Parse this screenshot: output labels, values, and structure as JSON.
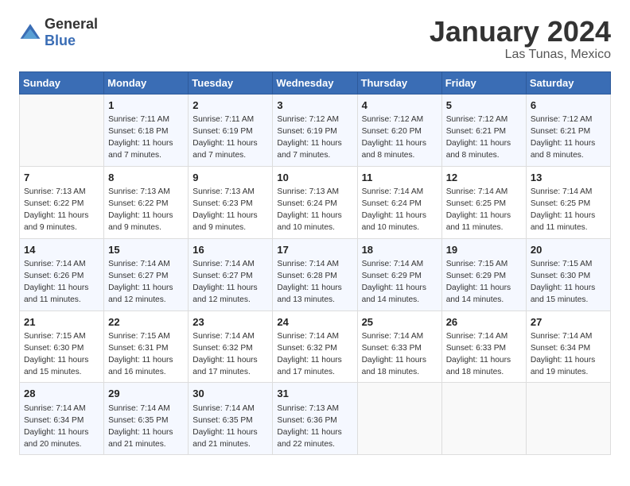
{
  "header": {
    "logo_general": "General",
    "logo_blue": "Blue",
    "month_title": "January 2024",
    "location": "Las Tunas, Mexico"
  },
  "calendar": {
    "days_of_week": [
      "Sunday",
      "Monday",
      "Tuesday",
      "Wednesday",
      "Thursday",
      "Friday",
      "Saturday"
    ],
    "weeks": [
      [
        {
          "day": "",
          "info": ""
        },
        {
          "day": "1",
          "info": "Sunrise: 7:11 AM\nSunset: 6:18 PM\nDaylight: 11 hours\nand 7 minutes."
        },
        {
          "day": "2",
          "info": "Sunrise: 7:11 AM\nSunset: 6:19 PM\nDaylight: 11 hours\nand 7 minutes."
        },
        {
          "day": "3",
          "info": "Sunrise: 7:12 AM\nSunset: 6:19 PM\nDaylight: 11 hours\nand 7 minutes."
        },
        {
          "day": "4",
          "info": "Sunrise: 7:12 AM\nSunset: 6:20 PM\nDaylight: 11 hours\nand 8 minutes."
        },
        {
          "day": "5",
          "info": "Sunrise: 7:12 AM\nSunset: 6:21 PM\nDaylight: 11 hours\nand 8 minutes."
        },
        {
          "day": "6",
          "info": "Sunrise: 7:12 AM\nSunset: 6:21 PM\nDaylight: 11 hours\nand 8 minutes."
        }
      ],
      [
        {
          "day": "7",
          "info": "Sunrise: 7:13 AM\nSunset: 6:22 PM\nDaylight: 11 hours\nand 9 minutes."
        },
        {
          "day": "8",
          "info": "Sunrise: 7:13 AM\nSunset: 6:22 PM\nDaylight: 11 hours\nand 9 minutes."
        },
        {
          "day": "9",
          "info": "Sunrise: 7:13 AM\nSunset: 6:23 PM\nDaylight: 11 hours\nand 9 minutes."
        },
        {
          "day": "10",
          "info": "Sunrise: 7:13 AM\nSunset: 6:24 PM\nDaylight: 11 hours\nand 10 minutes."
        },
        {
          "day": "11",
          "info": "Sunrise: 7:14 AM\nSunset: 6:24 PM\nDaylight: 11 hours\nand 10 minutes."
        },
        {
          "day": "12",
          "info": "Sunrise: 7:14 AM\nSunset: 6:25 PM\nDaylight: 11 hours\nand 11 minutes."
        },
        {
          "day": "13",
          "info": "Sunrise: 7:14 AM\nSunset: 6:25 PM\nDaylight: 11 hours\nand 11 minutes."
        }
      ],
      [
        {
          "day": "14",
          "info": "Sunrise: 7:14 AM\nSunset: 6:26 PM\nDaylight: 11 hours\nand 11 minutes."
        },
        {
          "day": "15",
          "info": "Sunrise: 7:14 AM\nSunset: 6:27 PM\nDaylight: 11 hours\nand 12 minutes."
        },
        {
          "day": "16",
          "info": "Sunrise: 7:14 AM\nSunset: 6:27 PM\nDaylight: 11 hours\nand 12 minutes."
        },
        {
          "day": "17",
          "info": "Sunrise: 7:14 AM\nSunset: 6:28 PM\nDaylight: 11 hours\nand 13 minutes."
        },
        {
          "day": "18",
          "info": "Sunrise: 7:14 AM\nSunset: 6:29 PM\nDaylight: 11 hours\nand 14 minutes."
        },
        {
          "day": "19",
          "info": "Sunrise: 7:15 AM\nSunset: 6:29 PM\nDaylight: 11 hours\nand 14 minutes."
        },
        {
          "day": "20",
          "info": "Sunrise: 7:15 AM\nSunset: 6:30 PM\nDaylight: 11 hours\nand 15 minutes."
        }
      ],
      [
        {
          "day": "21",
          "info": "Sunrise: 7:15 AM\nSunset: 6:30 PM\nDaylight: 11 hours\nand 15 minutes."
        },
        {
          "day": "22",
          "info": "Sunrise: 7:15 AM\nSunset: 6:31 PM\nDaylight: 11 hours\nand 16 minutes."
        },
        {
          "day": "23",
          "info": "Sunrise: 7:14 AM\nSunset: 6:32 PM\nDaylight: 11 hours\nand 17 minutes."
        },
        {
          "day": "24",
          "info": "Sunrise: 7:14 AM\nSunset: 6:32 PM\nDaylight: 11 hours\nand 17 minutes."
        },
        {
          "day": "25",
          "info": "Sunrise: 7:14 AM\nSunset: 6:33 PM\nDaylight: 11 hours\nand 18 minutes."
        },
        {
          "day": "26",
          "info": "Sunrise: 7:14 AM\nSunset: 6:33 PM\nDaylight: 11 hours\nand 18 minutes."
        },
        {
          "day": "27",
          "info": "Sunrise: 7:14 AM\nSunset: 6:34 PM\nDaylight: 11 hours\nand 19 minutes."
        }
      ],
      [
        {
          "day": "28",
          "info": "Sunrise: 7:14 AM\nSunset: 6:34 PM\nDaylight: 11 hours\nand 20 minutes."
        },
        {
          "day": "29",
          "info": "Sunrise: 7:14 AM\nSunset: 6:35 PM\nDaylight: 11 hours\nand 21 minutes."
        },
        {
          "day": "30",
          "info": "Sunrise: 7:14 AM\nSunset: 6:35 PM\nDaylight: 11 hours\nand 21 minutes."
        },
        {
          "day": "31",
          "info": "Sunrise: 7:13 AM\nSunset: 6:36 PM\nDaylight: 11 hours\nand 22 minutes."
        },
        {
          "day": "",
          "info": ""
        },
        {
          "day": "",
          "info": ""
        },
        {
          "day": "",
          "info": ""
        }
      ]
    ]
  }
}
